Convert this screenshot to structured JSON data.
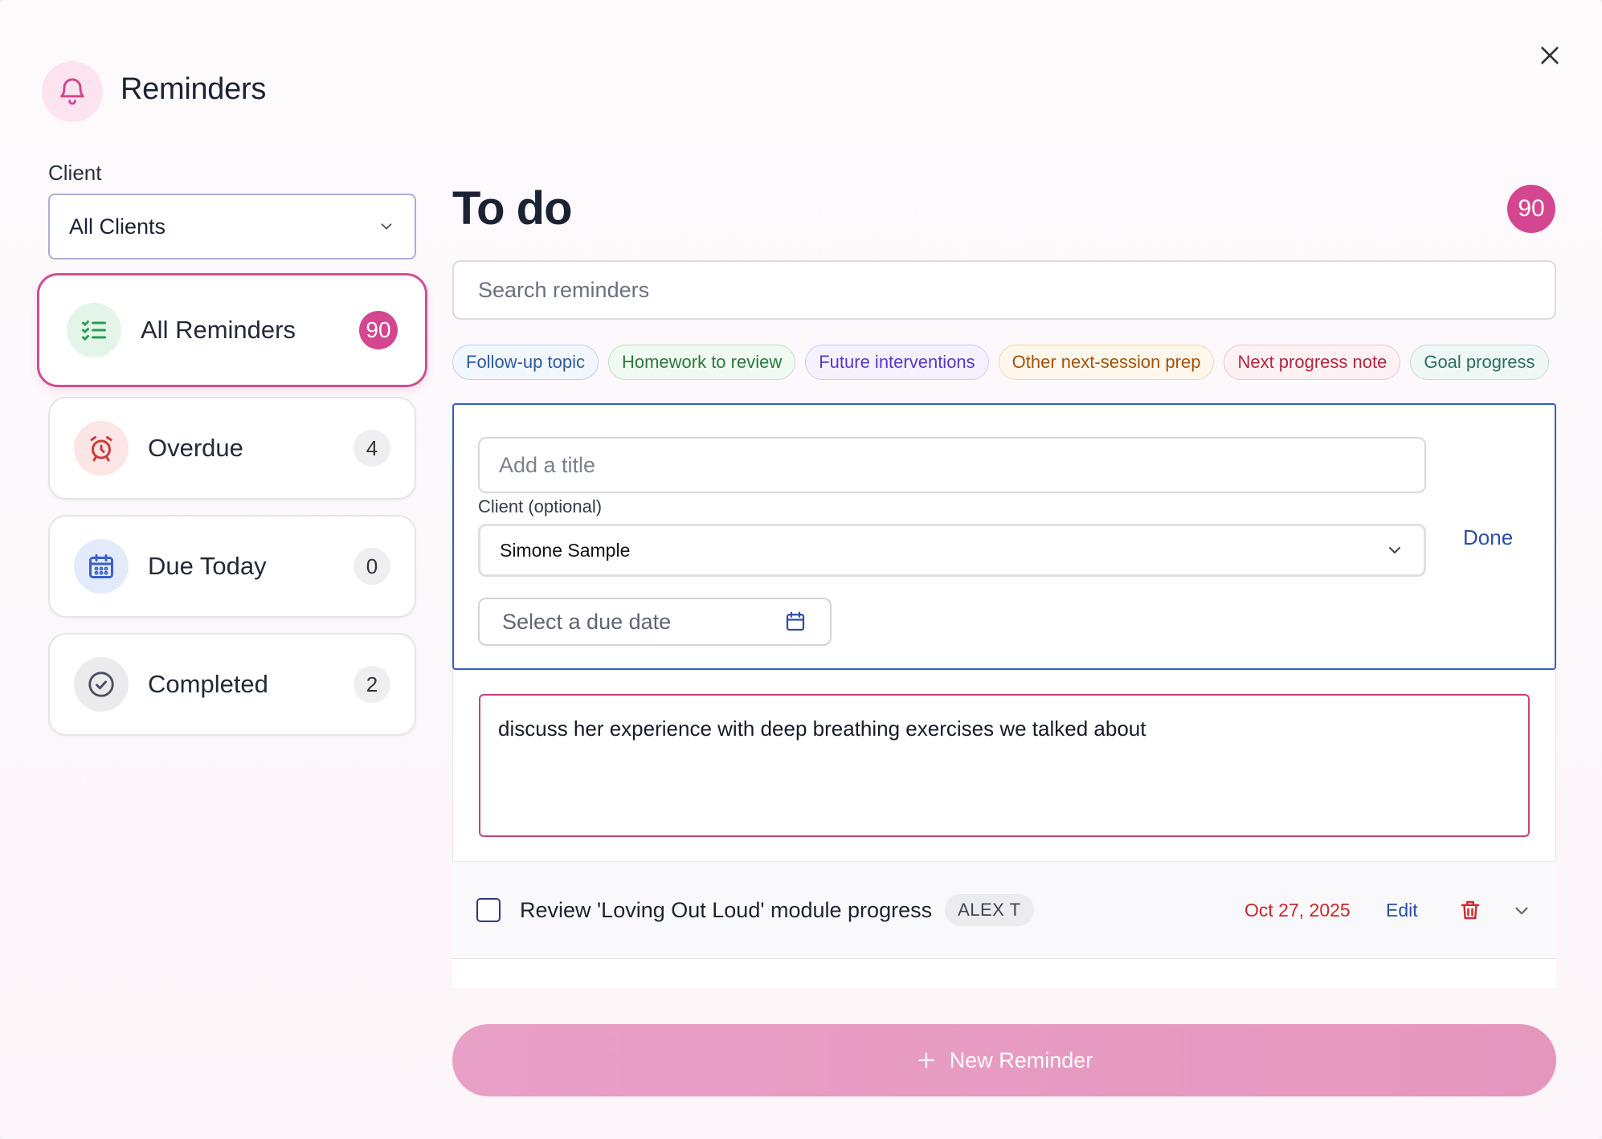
{
  "header": {
    "title": "Reminders",
    "icon": "bell-icon"
  },
  "sidebar": {
    "client_label": "Client",
    "client_value": "All Clients",
    "categories": [
      {
        "label": "All Reminders",
        "count": "90",
        "icon": "checklist-icon",
        "color": "#2e9a57"
      },
      {
        "label": "Overdue",
        "count": "4",
        "icon": "alarm-clock-icon",
        "color": "#d13a3a"
      },
      {
        "label": "Due Today",
        "count": "0",
        "icon": "calendar-icon",
        "color": "#3c5fc9"
      },
      {
        "label": "Completed",
        "count": "2",
        "icon": "check-circle-icon",
        "color": "#4a4f5a"
      }
    ]
  },
  "main": {
    "title": "To do",
    "count": "90",
    "search_placeholder": "Search reminders",
    "chips": [
      {
        "label": "Follow-up topic",
        "color": "#2c5b9e",
        "bg": "#f2f6fd",
        "border": "#bdd0ee"
      },
      {
        "label": "Homework to review",
        "color": "#2a7a3b",
        "bg": "#f1faf2",
        "border": "#bfe0c5"
      },
      {
        "label": "Future interventions",
        "color": "#5a38c4",
        "bg": "#f5f2fd",
        "border": "#d4c9f2"
      },
      {
        "label": "Other next-session prep",
        "color": "#a3530e",
        "bg": "#fff7ec",
        "border": "#f2d6ad"
      },
      {
        "label": "Next progress note",
        "color": "#b3263f",
        "bg": "#fdf1f3",
        "border": "#f0c5cd"
      },
      {
        "label": "Goal progress",
        "color": "#2a6f5e",
        "bg": "#eff8f5",
        "border": "#bfe0d6"
      }
    ]
  },
  "editor": {
    "title_placeholder": "Add a title",
    "client_label": "Client (optional)",
    "client_value": "Simone Sample",
    "date_placeholder": "Select a due date",
    "done_label": "Done",
    "notes": "discuss her experience with deep breathing exercises we talked about"
  },
  "reminders": [
    {
      "title": "Review 'Loving Out Loud' module progress",
      "client": "ALEX T",
      "date": "Oct 27, 2025",
      "edit_label": "Edit"
    }
  ],
  "new_button": {
    "label": "New Reminder"
  },
  "colors": {
    "accent": "#d4468f",
    "link": "#2f4ea6",
    "overdue": "#c8272c"
  }
}
